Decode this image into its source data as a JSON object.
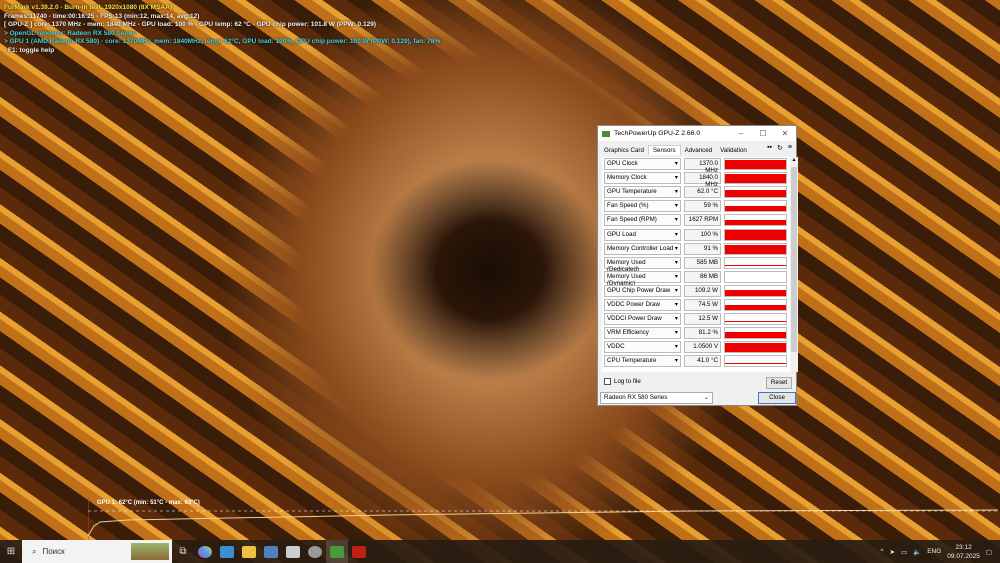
{
  "furmark": {
    "lines": [
      "FurMark v1.39.2.0 - Burn-in test, 1920x1080 (8X MSAA)",
      "Frames:11740 - time:00:16:25 - FPS:13 (min:12, max:14, avg:12)",
      "[ GPU-Z ] core: 1370 MHz - mem: 1840 MHz - GPU load: 100 % - GPU temp: 62 °C - GPU chip power: 101.8 W (PPW: 0.129)",
      "> OpenGL renderer: Radeon RX 580 Series",
      "> GPU 1 (AMD Radeon RX 580) - core: 1370MHz, mem: 1840MHz, temp: 62°C, GPU load: 100%, GPU chip power: 100 W (PPW: 0.129), fan: 78%",
      "- F1: toggle help"
    ],
    "graph_label": "GPU 1: 62°C (min: 51°C - max: 63°C)"
  },
  "gpuz": {
    "title": "TechPowerUp GPU-Z 2.66.0",
    "tabs": [
      "Graphics Card",
      "Sensors",
      "Advanced",
      "Validation"
    ],
    "sensors": [
      {
        "label": "GPU Clock",
        "value": "1370.0 MHz",
        "fill": 0.95
      },
      {
        "label": "Memory Clock",
        "value": "1840.0 MHz",
        "fill": 0.95
      },
      {
        "label": "GPU Temperature",
        "value": "62.0 °C",
        "fill": 0.7
      },
      {
        "label": "Fan Speed (%)",
        "value": "59 %",
        "fill": 0.55
      },
      {
        "label": "Fan Speed (RPM)",
        "value": "1627 RPM",
        "fill": 0.55
      },
      {
        "label": "GPU Load",
        "value": "100 %",
        "fill": 0.95
      },
      {
        "label": "Memory Controller Load",
        "value": "91 %",
        "fill": 0.85
      },
      {
        "label": "Memory Used (Dedicated)",
        "value": "585 MB",
        "fill": 0.05
      },
      {
        "label": "Memory Used (Dynamic)",
        "value": "86 MB",
        "fill": 0
      },
      {
        "label": "GPU Chip Power Draw",
        "value": "109.2 W",
        "fill": 0.6
      },
      {
        "label": "VDDC Power Draw",
        "value": "74.5 W",
        "fill": 0.5
      },
      {
        "label": "VDDCI Power Draw",
        "value": "12.5 W",
        "fill": 0.05
      },
      {
        "label": "VRM Efficiency",
        "value": "81.2 %",
        "fill": 0.65
      },
      {
        "label": "VDDC",
        "value": "1.0500 V",
        "fill": 0.95
      },
      {
        "label": "CPU Temperature",
        "value": "41.0 °C",
        "fill": 0.05
      }
    ],
    "log_label": "Log to file",
    "reset": "Reset",
    "gpu_select": "Radeon RX 580 Series",
    "close": "Close"
  },
  "taskbar": {
    "search": "Поиск",
    "lang": "ENG",
    "time": "23:12",
    "date": "09.07.2025"
  }
}
